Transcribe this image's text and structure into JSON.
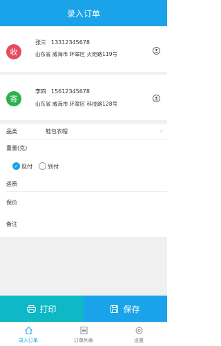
{
  "header": {
    "title": "录入订单"
  },
  "recipient": {
    "avatar": "收",
    "name": "张三",
    "phone": "13312345678",
    "address": "山东省 威海市 环翠区 火炬路119号",
    "color": "#e84a5f"
  },
  "sender": {
    "avatar": "寄",
    "name": "李四",
    "phone": "15612345678",
    "address": "山东省 威海市 环翠区 科技路128号",
    "color": "#2bb24c"
  },
  "form": {
    "category_label": "品类",
    "category_value": "鞋包衣帽",
    "weight_label": "重量(克)",
    "payment_options": [
      "现付",
      "到付"
    ],
    "payment_selected": "现付",
    "freight_label": "运费",
    "insurance_label": "保价",
    "remark_label": "备注"
  },
  "actions": {
    "print_label": "打印",
    "save_label": "保存"
  },
  "tabs": [
    {
      "label": "录入订单",
      "icon": "home-icon",
      "active": true
    },
    {
      "label": "订单列表",
      "icon": "list-icon",
      "active": false
    },
    {
      "label": "设置",
      "icon": "settings-icon",
      "active": false
    }
  ],
  "colors": {
    "primary": "#1aa3e8",
    "print": "#0fb8c6"
  }
}
